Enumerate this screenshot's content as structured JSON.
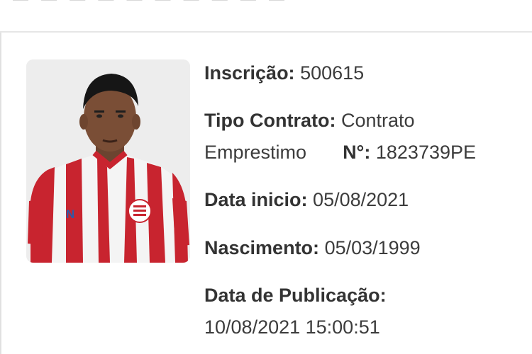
{
  "header": {
    "partial_text": "— — — — — — — — — —"
  },
  "player": {
    "inscricao_label": "Inscrição:",
    "inscricao_value": "500615",
    "tipo_contrato_label": "Tipo Contrato:",
    "tipo_contrato_value_1": "Contrato",
    "tipo_contrato_value_2": "Emprestimo",
    "numero_label": "N°:",
    "numero_value": "1823739PE",
    "data_inicio_label": "Data inicio:",
    "data_inicio_value": "05/08/2021",
    "nascimento_label": "Nascimento:",
    "nascimento_value": "05/03/1999",
    "publicacao_label": "Data de Publicação:",
    "publicacao_value": "10/08/2021 15:00:51"
  },
  "colors": {
    "jersey_red": "#c8242f",
    "jersey_white": "#f4f4f4",
    "background": "#ffffff"
  }
}
